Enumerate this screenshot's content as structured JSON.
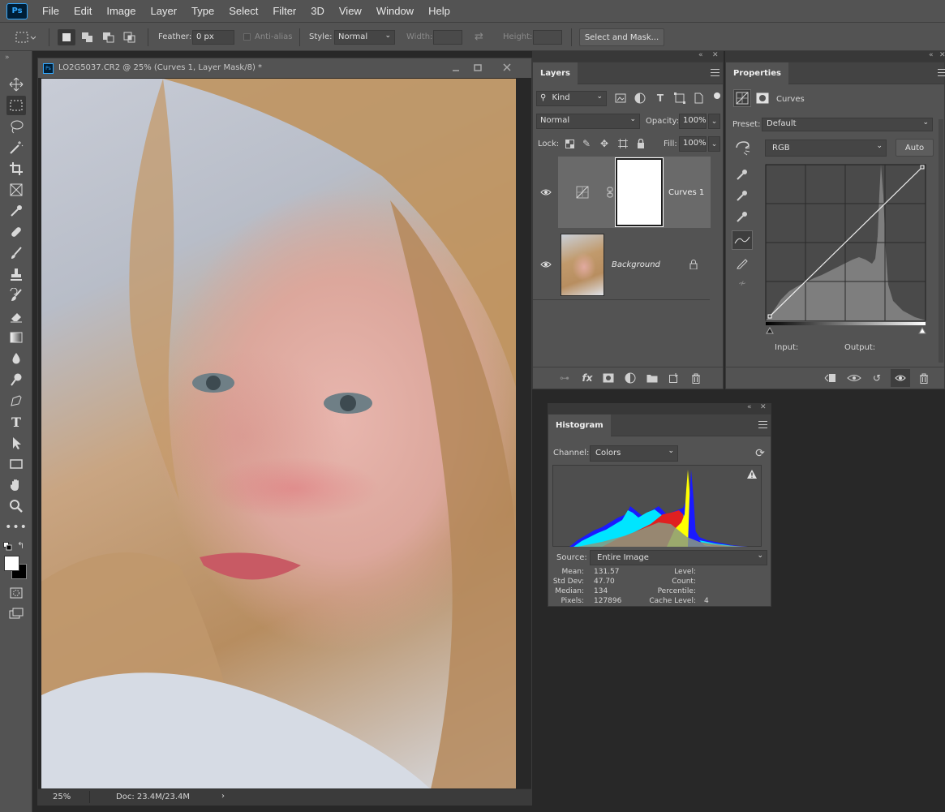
{
  "app": {
    "logo": "Ps"
  },
  "menu": [
    "File",
    "Edit",
    "Image",
    "Layer",
    "Type",
    "Select",
    "Filter",
    "3D",
    "View",
    "Window",
    "Help"
  ],
  "options": {
    "feather_label": "Feather:",
    "feather_value": "0 px",
    "antialias_label": "Anti-alias",
    "style_label": "Style:",
    "style_value": "Normal",
    "width_label": "Width:",
    "height_label": "Height:",
    "select_mask": "Select and Mask..."
  },
  "document": {
    "title": "LO2G5037.CR2 @ 25% (Curves 1, Layer Mask/8) *",
    "zoom": "25%",
    "doc_info": "Doc: 23.4M/23.4M"
  },
  "layers": {
    "tab": "Layers",
    "kind": "Kind",
    "blend": "Normal",
    "opacity_label": "Opacity:",
    "opacity": "100%",
    "lock_label": "Lock:",
    "fill_label": "Fill:",
    "fill": "100%",
    "items": [
      {
        "name": "Curves 1"
      },
      {
        "name": "Background"
      }
    ]
  },
  "properties": {
    "tab": "Properties",
    "type": "Curves",
    "preset_label": "Preset:",
    "preset": "Default",
    "channel": "RGB",
    "auto": "Auto",
    "input_label": "Input:",
    "output_label": "Output:"
  },
  "histogram": {
    "tab": "Histogram",
    "channel_label": "Channel:",
    "channel": "Colors",
    "source_label": "Source:",
    "source": "Entire Image",
    "stats": {
      "mean_label": "Mean:",
      "mean": "131.57",
      "std_label": "Std Dev:",
      "std": "47.70",
      "median_label": "Median:",
      "median": "134",
      "pixels_label": "Pixels:",
      "pixels": "127896",
      "level_label": "Level:",
      "count_label": "Count:",
      "percentile_label": "Percentile:",
      "cache_label": "Cache Level:",
      "cache": "4"
    }
  },
  "colors": {
    "ui_dark": "#535353",
    "ui_bg": "#282828",
    "accent": "#31a8ff",
    "hist_red": "#e02020",
    "hist_yellow": "#ffff00",
    "hist_blue": "#1a1aff",
    "hist_cyan": "#00e5ff"
  }
}
